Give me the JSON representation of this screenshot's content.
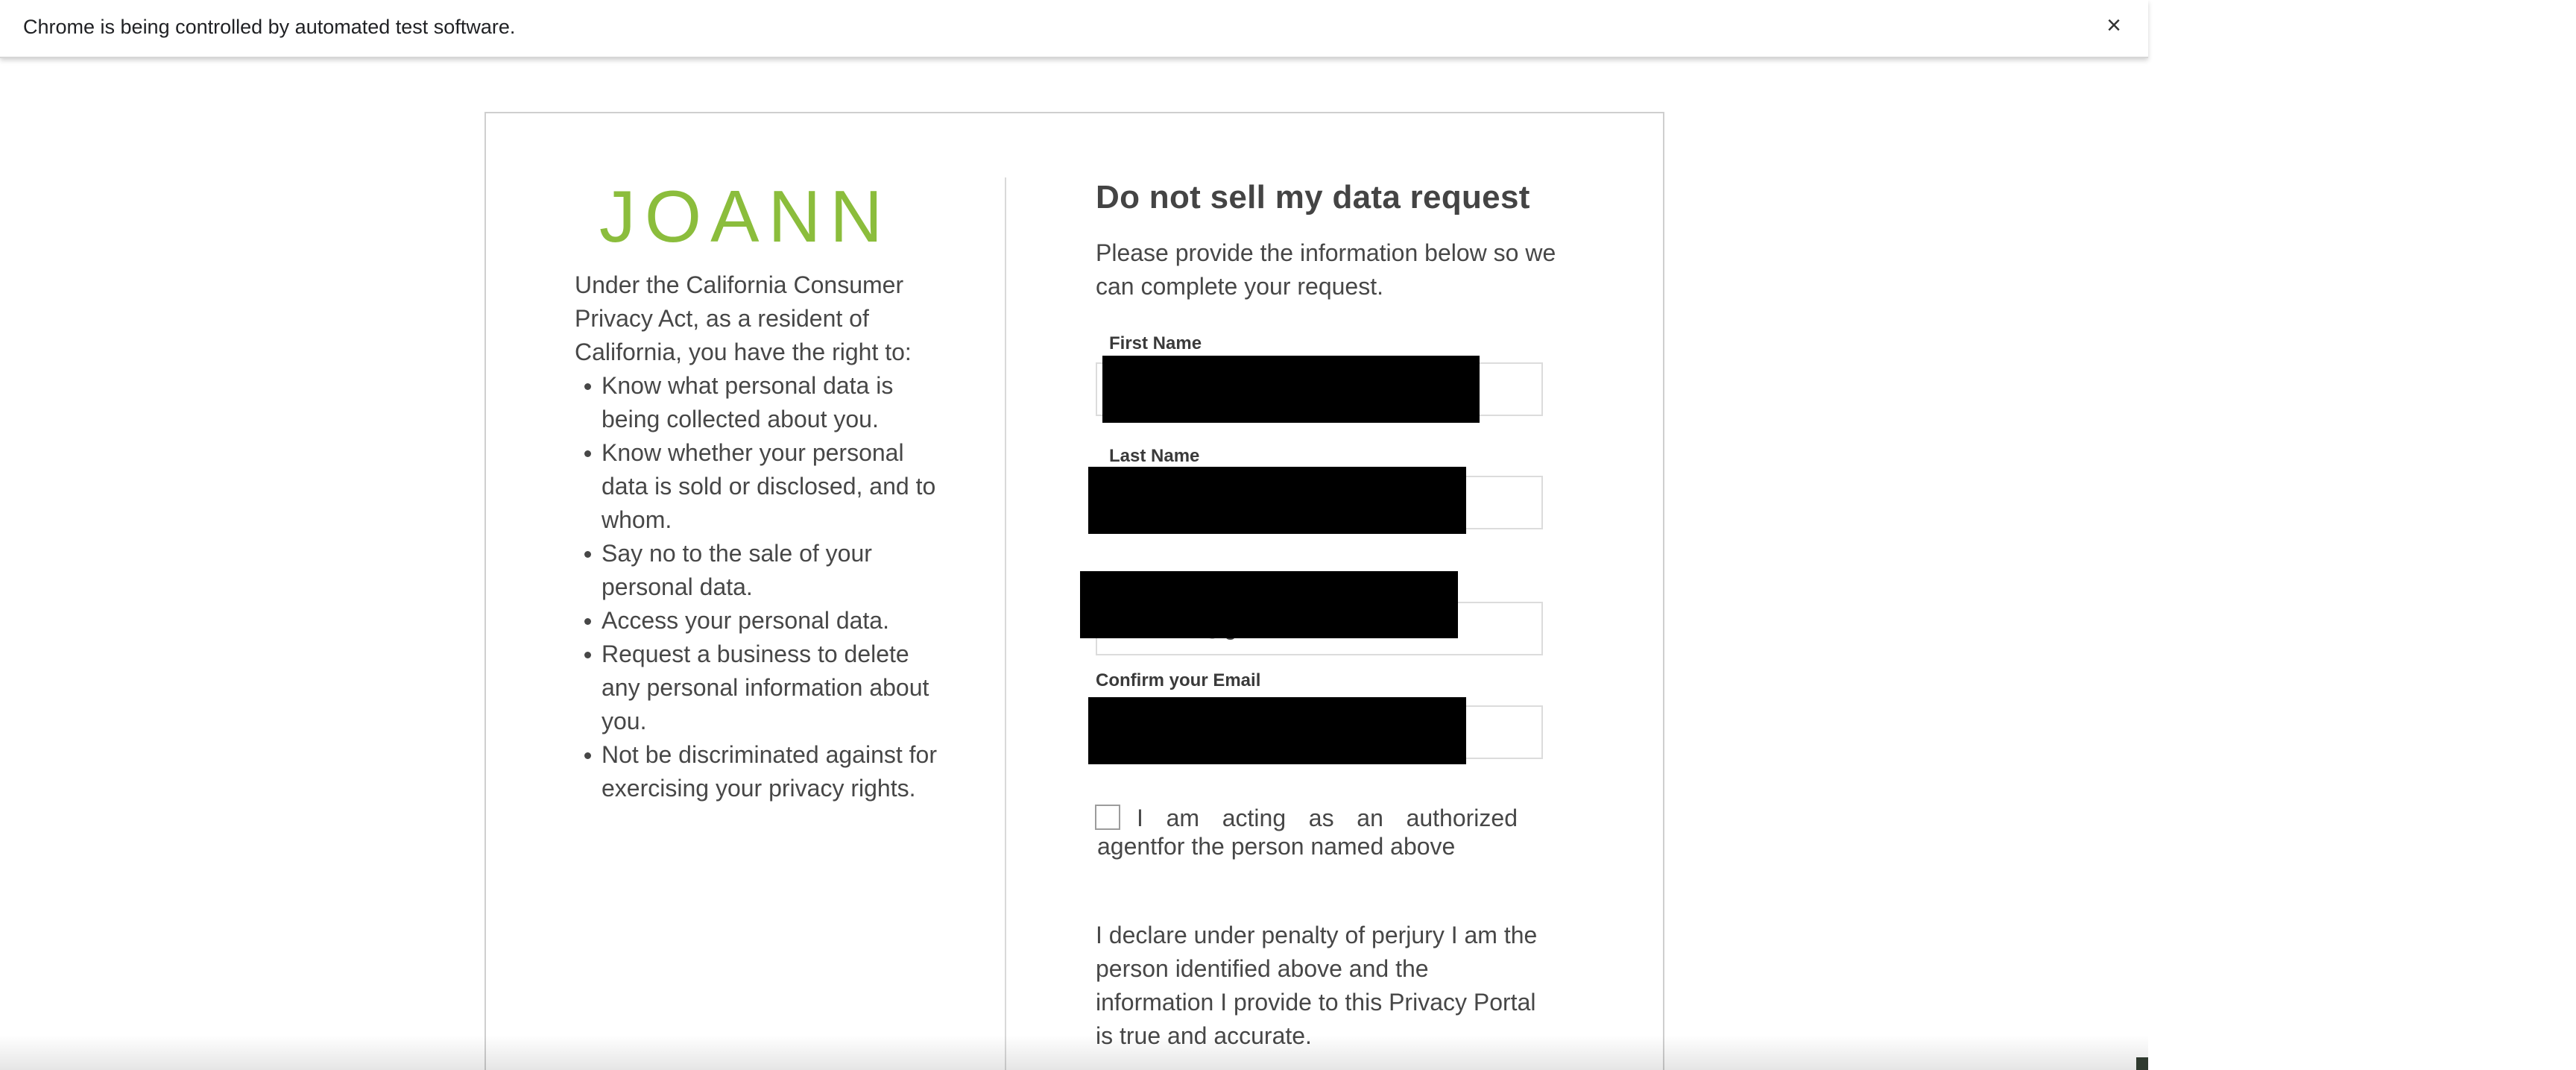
{
  "infobar": {
    "message": "Chrome is being controlled by automated test software.",
    "close_icon": "close-icon",
    "close_glyph": "×"
  },
  "left": {
    "logo_text": "JOANN",
    "intro": "Under the California Consumer Privacy Act, as a resident of California, you have the right to:",
    "rights": [
      "Know what personal data is being collected about you.",
      "Know whether your personal data is sold or disclosed, and to whom.",
      "Say no to the sale of your personal data.",
      "Access your personal data.",
      "Request a business to delete any personal information about you.",
      "Not be discriminated against for exercising your privacy rights."
    ]
  },
  "form": {
    "title": "Do not sell my data request",
    "subtitle": "Please provide the information below so we can complete your request.",
    "first_name_label": "First Name",
    "last_name_label": "Last Name",
    "email_value_visible": "@g",
    "confirm_email_label": "Confirm your Email",
    "agent_checkbox_label": "I am acting as an authorized agentfor the person named above",
    "agent_checked": false,
    "declaration": "I declare under penalty of perjury I am the person identified above and the information I provide to this Privacy Portal is true and accurate."
  },
  "colors": {
    "brand_green": "#8bbd3c",
    "text": "#474747",
    "redaction": "#000000"
  }
}
